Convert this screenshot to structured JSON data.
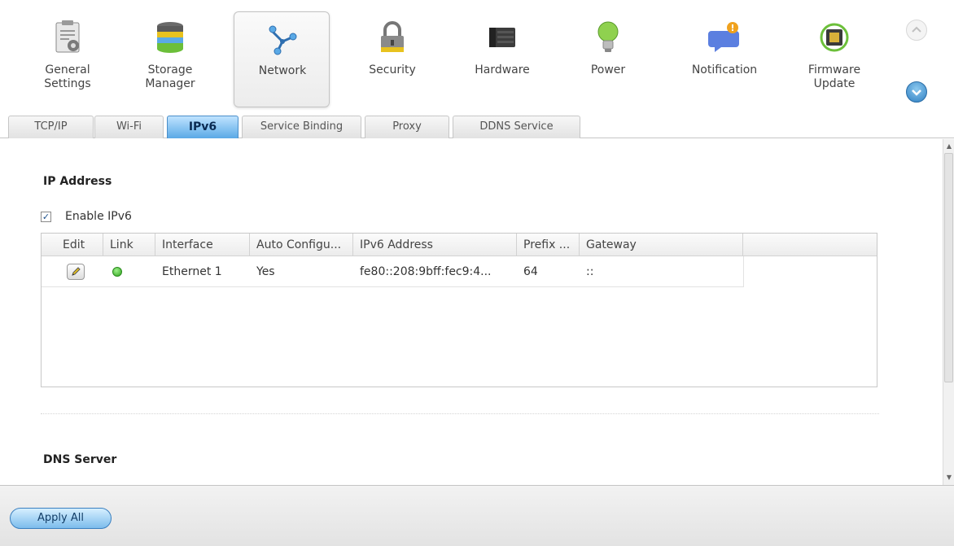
{
  "toolbar": {
    "items": [
      {
        "label": "General\nSettings",
        "icon": "clipboard-settings-icon"
      },
      {
        "label": "Storage\nManager",
        "icon": "disk-stack-icon"
      },
      {
        "label": "Network",
        "icon": "network-icon"
      },
      {
        "label": "Security",
        "icon": "padlock-icon"
      },
      {
        "label": "Hardware",
        "icon": "nas-hardware-icon"
      },
      {
        "label": "Power",
        "icon": "lightbulb-icon"
      },
      {
        "label": "Notification",
        "icon": "chat-bubble-icon"
      },
      {
        "label": "Firmware\nUpdate",
        "icon": "chip-update-icon"
      }
    ],
    "selected": "Network",
    "scroll_up": "⌃",
    "scroll_down": "⌄"
  },
  "tabs": [
    {
      "label": "TCP/IP"
    },
    {
      "label": "Wi-Fi"
    },
    {
      "label": "IPv6"
    },
    {
      "label": "Service Binding"
    },
    {
      "label": "Proxy"
    },
    {
      "label": "DDNS Service"
    }
  ],
  "active_tab": "IPv6",
  "ip_section": {
    "title": "IP Address",
    "enable_label": "Enable IPv6",
    "enable_checked": true,
    "check_mark": "✓"
  },
  "grid": {
    "columns": [
      "Edit",
      "Link",
      "Interface",
      "Auto Configu...",
      "IPv6 Address",
      "Prefix ...",
      "Gateway"
    ],
    "rows": [
      {
        "interface": "Ethernet 1",
        "auto_config": "Yes",
        "ipv6_address": "fe80::208:9bff:fec9:4...",
        "prefix": "64",
        "gateway": "::",
        "link_status_color": "#2fa31c"
      }
    ]
  },
  "dns_section": {
    "title": "DNS Server"
  },
  "footer": {
    "apply_label": "Apply All"
  },
  "colors": {
    "accent": "#4a8ec9",
    "link_up": "#2fa31c"
  }
}
